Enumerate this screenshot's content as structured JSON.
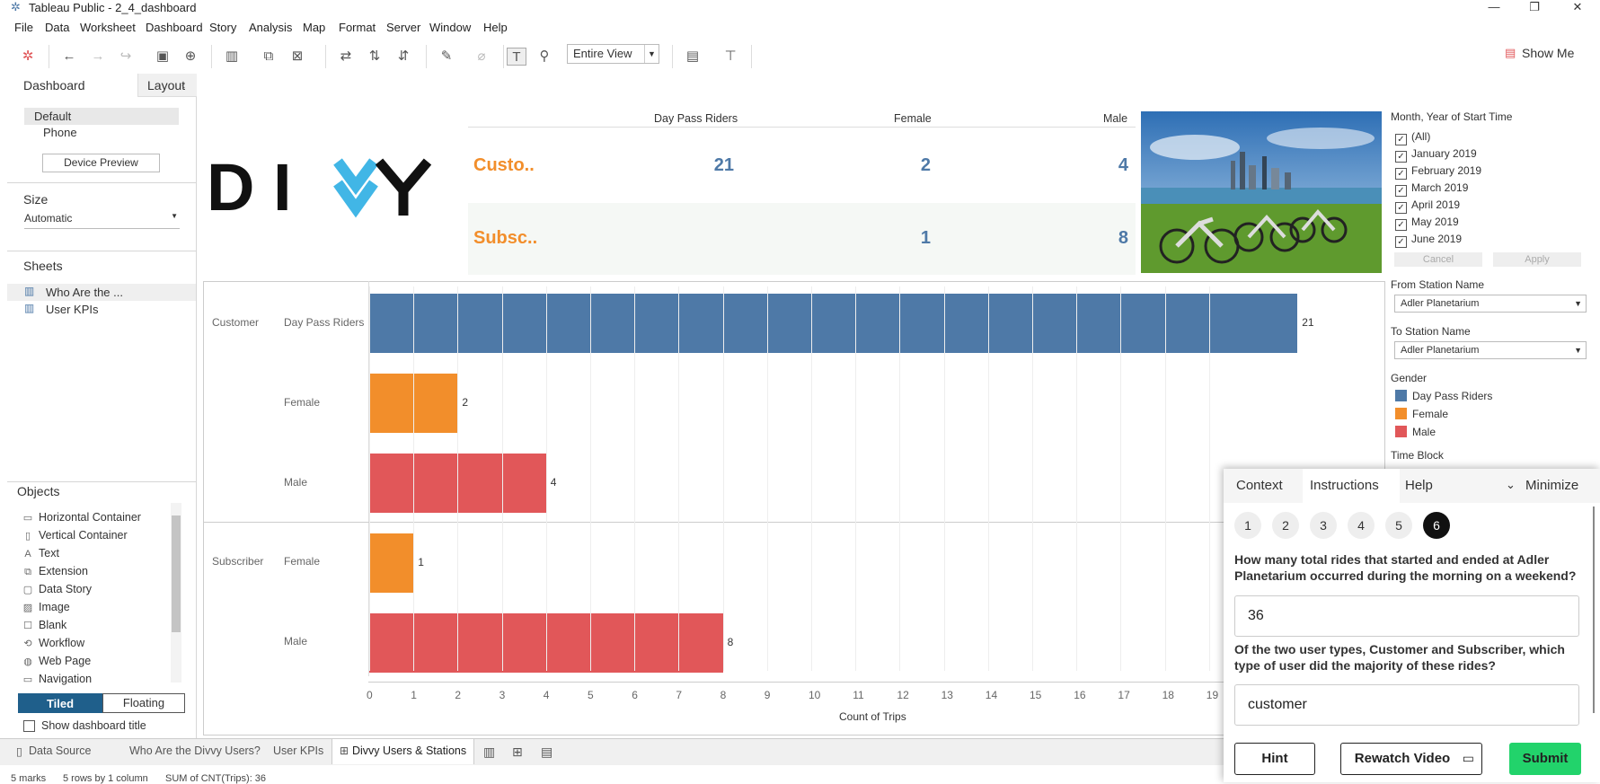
{
  "window": {
    "title": "Tableau Public - 2_4_dashboard"
  },
  "menu": [
    "File",
    "Data",
    "Worksheet",
    "Dashboard",
    "Story",
    "Analysis",
    "Map",
    "Format",
    "Server",
    "Window",
    "Help"
  ],
  "toolbar": {
    "view_select": "Entire View",
    "show_me": "Show Me"
  },
  "left_pane": {
    "tabs": [
      "Dashboard",
      "Layout"
    ],
    "devices": [
      "Default",
      "Phone"
    ],
    "device_preview": "Device Preview",
    "size_heading": "Size",
    "size_value": "Automatic",
    "sheets_heading": "Sheets",
    "sheets": [
      "Who Are the ...",
      "User KPIs"
    ],
    "objects_heading": "Objects",
    "objects": [
      {
        "label": "Horizontal Container",
        "icon": "horizontal-container-icon"
      },
      {
        "label": "Vertical Container",
        "icon": "vertical-container-icon"
      },
      {
        "label": "Text",
        "icon": "text-icon"
      },
      {
        "label": "Extension",
        "icon": "extension-icon"
      },
      {
        "label": "Data Story",
        "icon": "data-story-icon"
      },
      {
        "label": "Image",
        "icon": "image-icon"
      },
      {
        "label": "Blank",
        "icon": "blank-icon"
      },
      {
        "label": "Workflow",
        "icon": "workflow-icon"
      },
      {
        "label": "Web Page",
        "icon": "web-page-icon"
      },
      {
        "label": "Navigation",
        "icon": "navigation-icon"
      }
    ],
    "tiled": "Tiled",
    "floating": "Floating",
    "show_title": "Show dashboard title"
  },
  "kpi": {
    "headers": [
      "Day Pass Riders",
      "Female",
      "Male"
    ],
    "rows": [
      {
        "label": "Custo..",
        "values": [
          "21",
          "2",
          "4"
        ]
      },
      {
        "label": "Subsc..",
        "values": [
          "",
          "1",
          "8"
        ]
      }
    ]
  },
  "logo_text": "DIVVY",
  "filters": {
    "month_heading": "Month, Year of Start Time",
    "months": [
      "(All)",
      "January 2019",
      "February 2019",
      "March 2019",
      "April 2019",
      "May 2019",
      "June 2019"
    ],
    "cancel": "Cancel",
    "apply": "Apply",
    "from_heading": "From Station Name",
    "from_value": "Adler Planetarium",
    "to_heading": "To Station Name",
    "to_value": "Adler Planetarium",
    "gender_heading": "Gender",
    "legend": [
      {
        "label": "Day Pass Riders",
        "color": "#4e79a7"
      },
      {
        "label": "Female",
        "color": "#f28e2b"
      },
      {
        "label": "Male",
        "color": "#e15759"
      }
    ],
    "timeblock_heading": "Time Block"
  },
  "chart_data": {
    "type": "bar",
    "orientation": "horizontal",
    "groups": [
      {
        "name": "Customer",
        "bars": [
          {
            "label": "Day Pass Riders",
            "value": 21,
            "color": "#4e79a7"
          },
          {
            "label": "Female",
            "value": 2,
            "color": "#f28e2b"
          },
          {
            "label": "Male",
            "value": 4,
            "color": "#e15759"
          }
        ]
      },
      {
        "name": "Subscriber",
        "bars": [
          {
            "label": "Female",
            "value": 1,
            "color": "#f28e2b"
          },
          {
            "label": "Male",
            "value": 8,
            "color": "#e15759"
          }
        ]
      }
    ],
    "xlabel": "Count of Trips",
    "xticks": [
      "0",
      "1",
      "2",
      "3",
      "4",
      "5",
      "6",
      "7",
      "8",
      "9",
      "10",
      "11",
      "12",
      "13",
      "14",
      "15",
      "16",
      "17",
      "18",
      "19"
    ],
    "xlim": [
      0,
      21.5
    ]
  },
  "bottom_tabs": [
    "Data Source",
    "Who Are the Divvy Users?",
    "User KPIs",
    "Divvy Users & Stations"
  ],
  "status": {
    "marks": "5 marks",
    "rows": "5 rows by 1 column",
    "sum": "SUM of CNT(Trips): 36"
  },
  "instructions": {
    "tabs": [
      "Context",
      "Instructions",
      "Help",
      "Minimize"
    ],
    "steps": [
      "1",
      "2",
      "3",
      "4",
      "5",
      "6"
    ],
    "q1": "How many total rides that started and ended at Adler Planetarium occurred during the morning on a weekend?",
    "a1": "36",
    "q2": "Of the two user types, Customer and Subscriber, which type of user did the majority of these rides?",
    "a2": "customer",
    "hint": "Hint",
    "rewatch": "Rewatch Video",
    "submit": "Submit"
  }
}
